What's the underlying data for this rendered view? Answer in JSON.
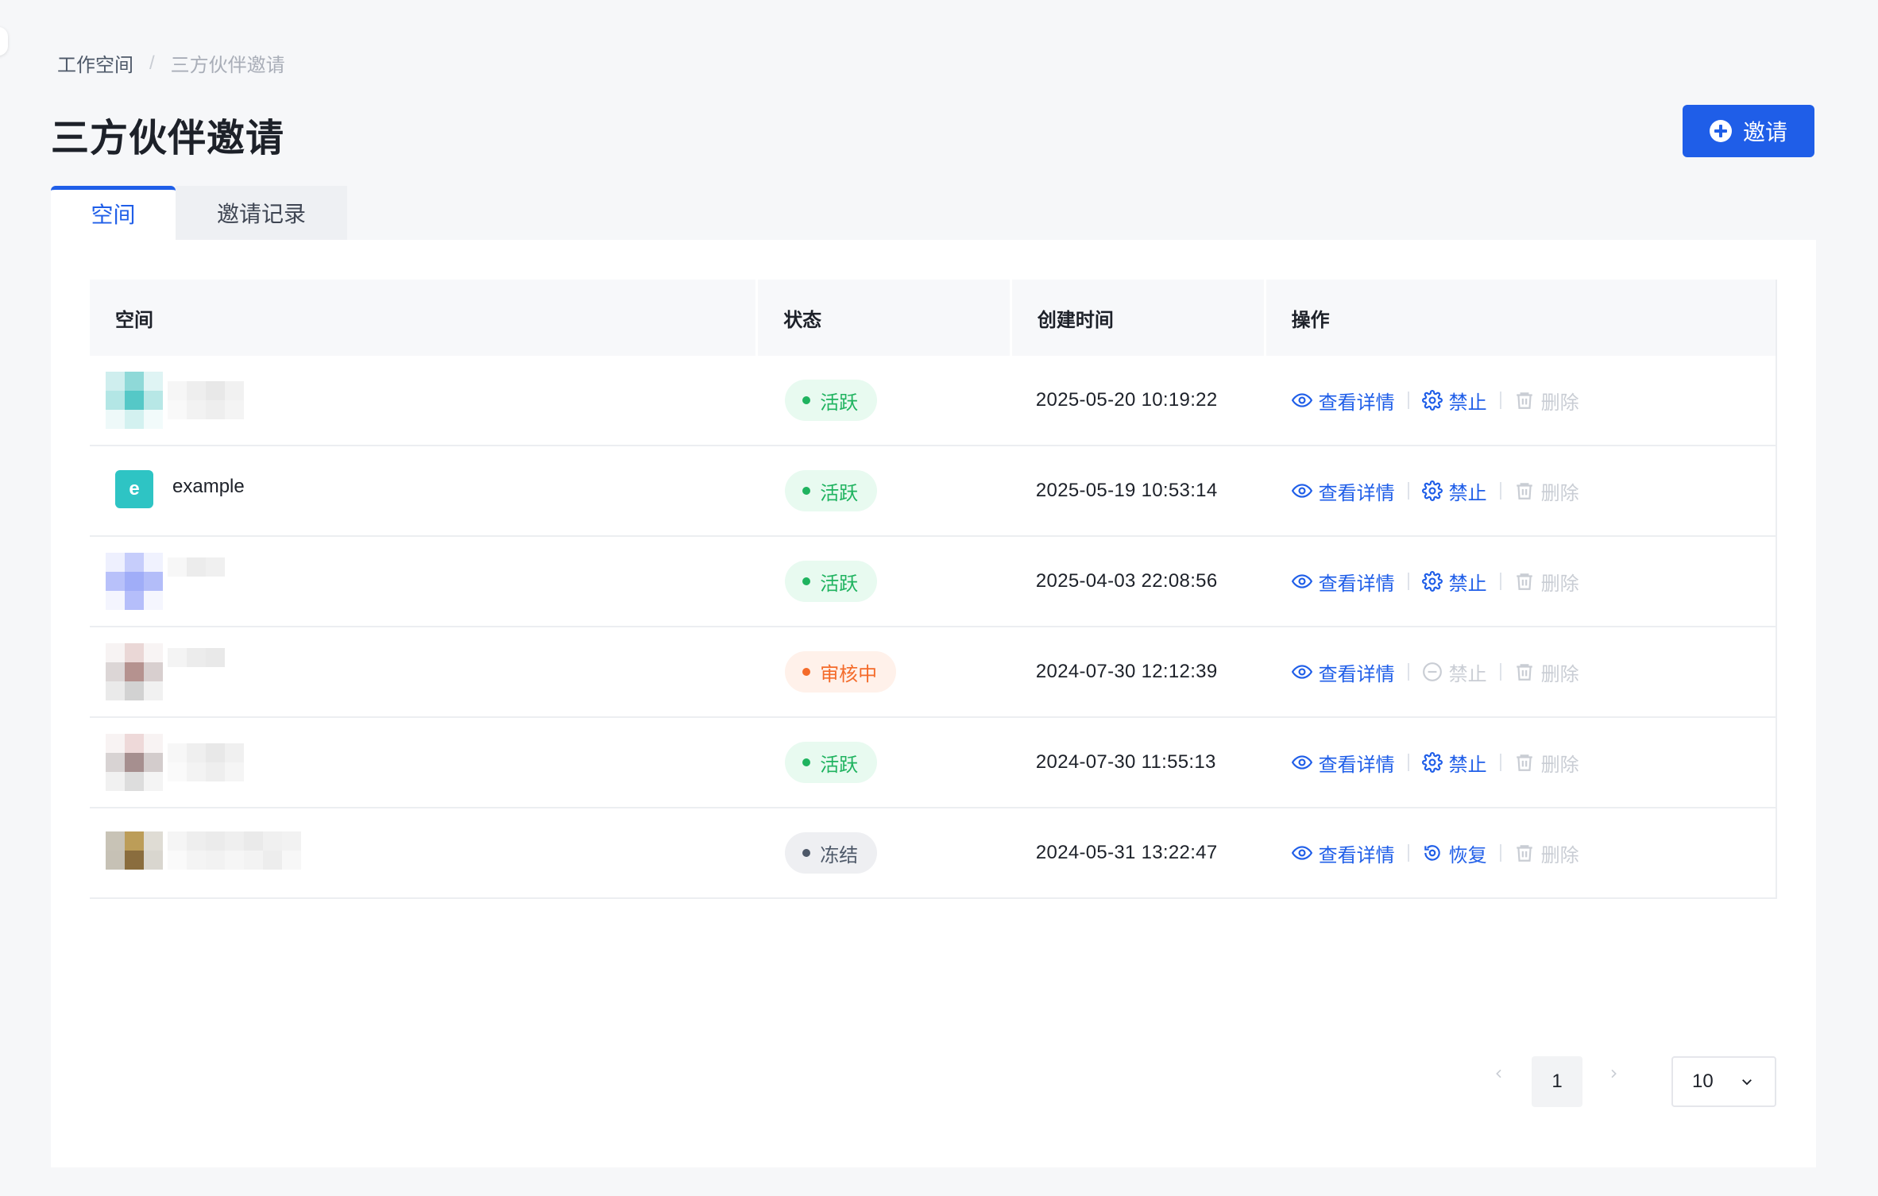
{
  "breadcrumb": {
    "root": "工作空间",
    "separator": "/",
    "current": "三方伙伴邀请"
  },
  "page": {
    "title": "三方伙伴邀请"
  },
  "invite_button": {
    "label": "邀请"
  },
  "tabs": [
    {
      "label": "空间",
      "active": true
    },
    {
      "label": "邀请记录",
      "active": false
    }
  ],
  "table": {
    "headers": {
      "space": "空间",
      "status": "状态",
      "created": "创建时间",
      "actions": "操作"
    },
    "rows": [
      {
        "space": "",
        "avatar_letter": "",
        "status": "活跃",
        "created": "2025-05-20 10:19:22",
        "view": "查看详情",
        "toggle": "禁止",
        "delete": "删除"
      },
      {
        "space": "example",
        "avatar_letter": "e",
        "status": "活跃",
        "created": "2025-05-19 10:53:14",
        "view": "查看详情",
        "toggle": "禁止",
        "delete": "删除"
      },
      {
        "space": "",
        "avatar_letter": "",
        "status": "活跃",
        "created": "2025-04-03 22:08:56",
        "view": "查看详情",
        "toggle": "禁止",
        "delete": "删除"
      },
      {
        "space": "",
        "avatar_letter": "",
        "status": "审核中",
        "created": "2024-07-30 12:12:39",
        "view": "查看详情",
        "toggle": "禁止",
        "delete": "删除"
      },
      {
        "space": "",
        "avatar_letter": "",
        "status": "活跃",
        "created": "2024-07-30 11:55:13",
        "view": "查看详情",
        "toggle": "禁止",
        "delete": "删除"
      },
      {
        "space": "",
        "avatar_letter": "",
        "status": "冻结",
        "created": "2024-05-31 13:22:47",
        "view": "查看详情",
        "toggle": "恢复",
        "delete": "删除"
      }
    ]
  },
  "pagination": {
    "current_page": "1",
    "page_size": "10"
  },
  "colors": {
    "primary": "#1f5ee8",
    "active_status": "#1fb35f",
    "pending_status": "#f46b2a",
    "frozen_status": "#4e5969",
    "avatar_teal": "#2ec4c4"
  },
  "icons": {
    "view": "eye-icon",
    "ban": "gear-icon",
    "ban_disabled": "minus-circle-icon",
    "restore": "restore-icon",
    "delete": "trash-icon",
    "invite": "plus-circle-icon"
  }
}
